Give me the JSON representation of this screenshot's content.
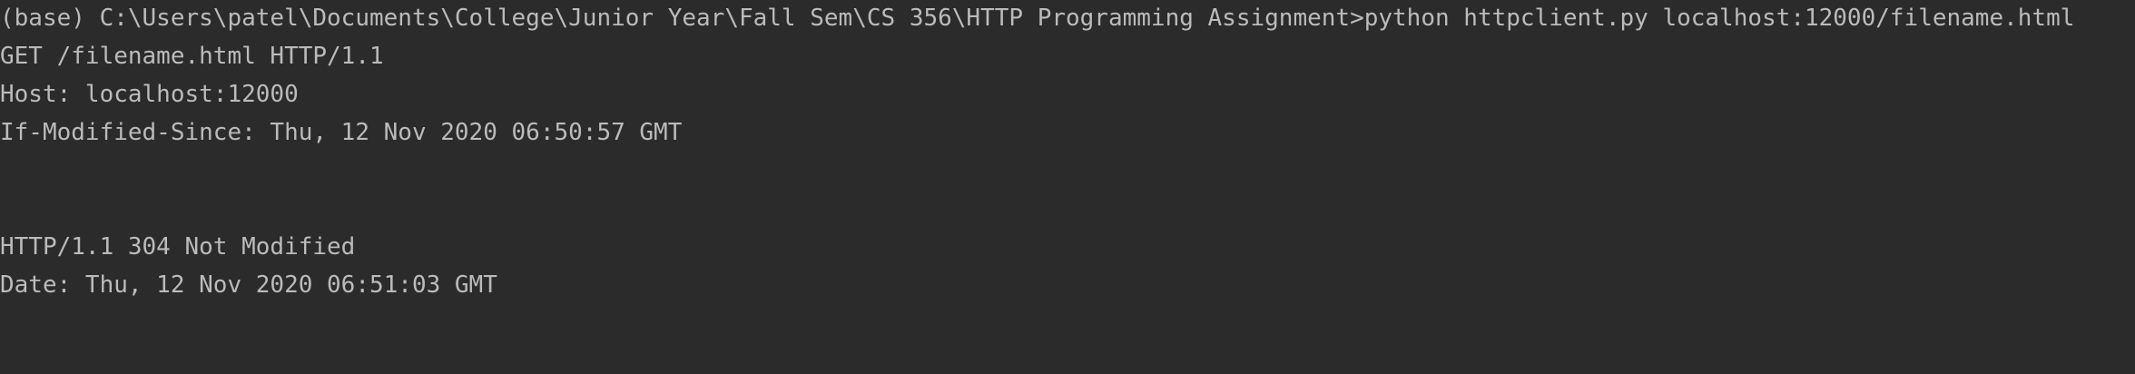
{
  "console": {
    "lines": [
      "(base) C:\\Users\\patel\\Documents\\College\\Junior Year\\Fall Sem\\CS 356\\HTTP Programming Assignment>python httpclient.py localhost:12000/filename.html",
      "GET /filename.html HTTP/1.1",
      "Host: localhost:12000",
      "If-Modified-Since: Thu, 12 Nov 2020 06:50:57 GMT",
      "",
      "",
      "HTTP/1.1 304 Not Modified",
      "Date: Thu, 12 Nov 2020 06:51:03 GMT"
    ]
  },
  "colors": {
    "background": "#2b2b2b",
    "text": "#bbbbbb"
  }
}
